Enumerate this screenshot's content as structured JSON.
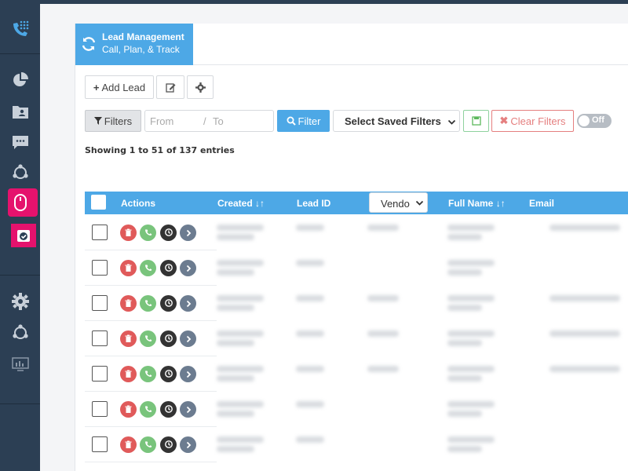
{
  "header": {
    "title": "Lead Management",
    "subtitle": "Call, Plan, & Track"
  },
  "toolbar": {
    "add_lead_label": "Add Lead",
    "edit_icon": "edit-icon",
    "settings_icon": "gear-icon"
  },
  "filters": {
    "filters_label": "Filters",
    "from_placeholder": "From",
    "to_placeholder": "To",
    "separator": "/",
    "filter_button_label": "Filter",
    "saved_filters_selected": "Select Saved Filters",
    "clear_filters_label": "Clear Filters",
    "toggle_label": "Off"
  },
  "table": {
    "showing_text": "Showing 1 to 51 of 137 entries",
    "columns": {
      "actions": "Actions",
      "created": "Created",
      "lead_id": "Lead ID",
      "vendor": "Vendo",
      "full_name": "Full Name",
      "email": "Email"
    },
    "row_count": 7
  },
  "colors": {
    "sidebar_bg": "#2c3f54",
    "accent": "#4da8e6",
    "active_item": "#e5126d",
    "delete": "#e05a5a",
    "call": "#79c47c",
    "history": "#333333",
    "go": "#6c7c90"
  },
  "sidebar": {
    "items": [
      "phone-icon",
      "pie-chart-icon",
      "contacts-folder-icon",
      "chat-icon",
      "network-icon",
      "mouse-icon",
      "lead-check-icon",
      "gear-icon",
      "share-icon",
      "monitor-chart-icon"
    ]
  }
}
